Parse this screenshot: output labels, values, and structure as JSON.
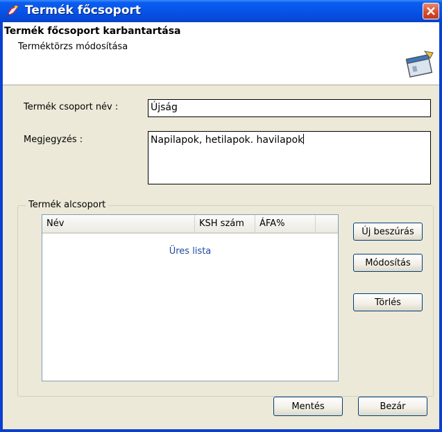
{
  "window": {
    "title": "Termék főcsoport",
    "close_icon": "close-icon"
  },
  "header": {
    "title": "Termék főcsoport karbantartása",
    "subtitle": "Terméktörzs módosítása",
    "icon": "window-edit-icon"
  },
  "form": {
    "group_name_label": "Termék csoport név :",
    "group_name_value": "Újság",
    "note_label": "Megjegyzés :",
    "note_value": "Napilapok, hetilapok. havilapok"
  },
  "subgroup": {
    "legend": "Termék alcsoport",
    "columns": [
      "Név",
      "KSH szám",
      "ÁFA%"
    ],
    "empty_text": "Üres lista",
    "rows": [],
    "buttons": {
      "new": "Új beszúrás",
      "edit": "Módosítás",
      "delete": "Törlés"
    }
  },
  "footer": {
    "save": "Mentés",
    "close": "Bezár"
  },
  "colors": {
    "titlebar": "#0754e8",
    "client_bg": "#ece9d8",
    "close_button": "#d9492a",
    "empty_text": "#1f4aa3"
  }
}
